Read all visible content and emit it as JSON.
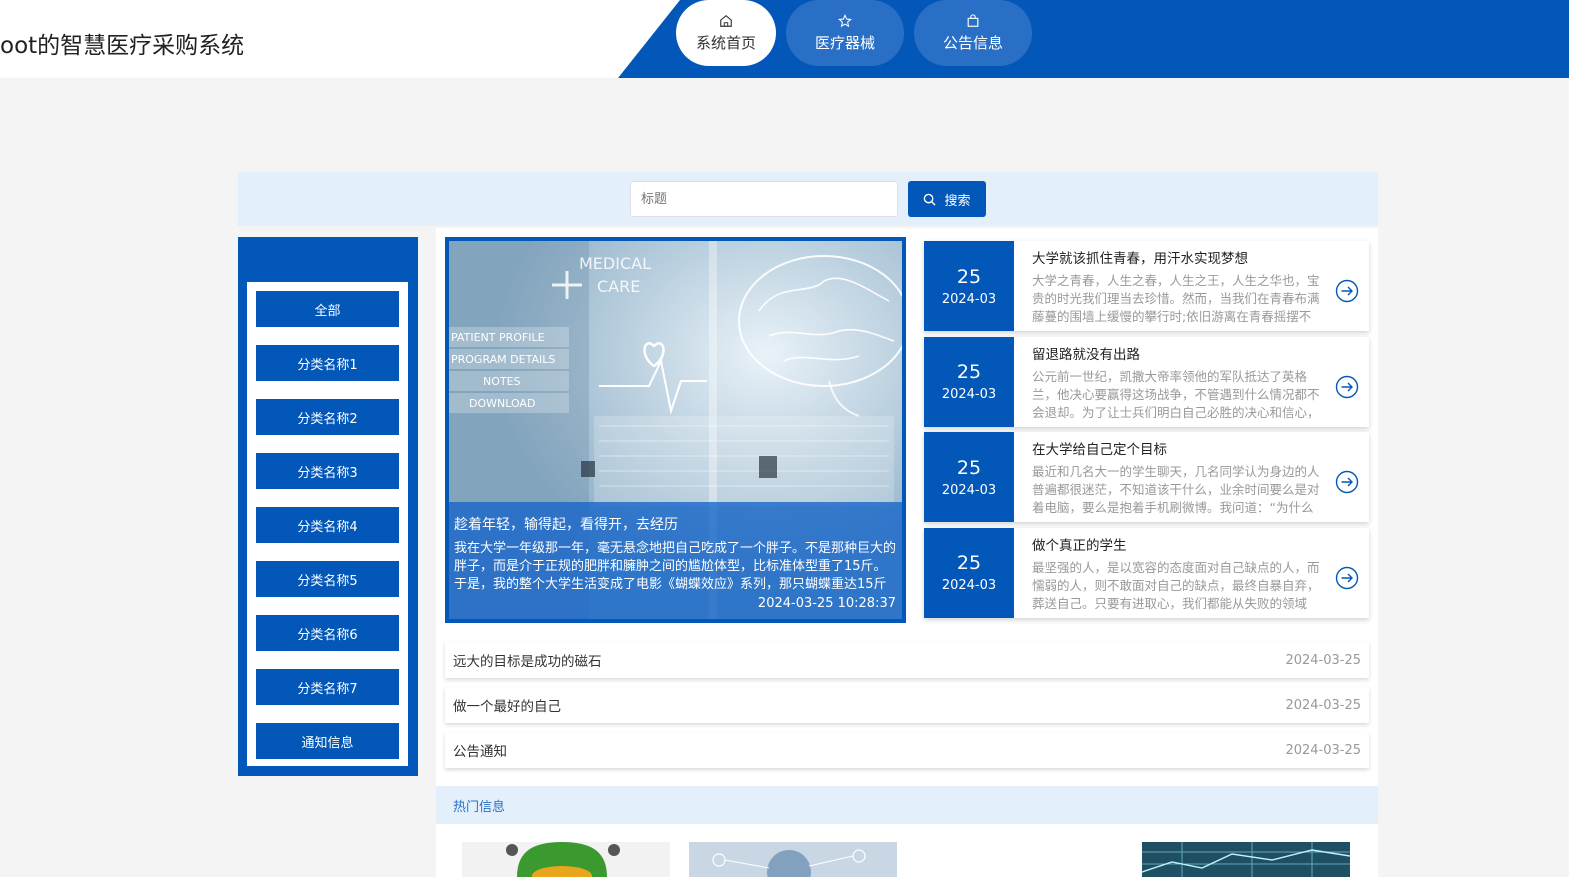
{
  "header": {
    "site_title": "oot的智慧医疗采购系统",
    "nav": [
      {
        "label": "系统首页",
        "icon": "home-icon",
        "active": true
      },
      {
        "label": "医疗器械",
        "icon": "star-icon",
        "active": false
      },
      {
        "label": "公告信息",
        "icon": "bag-icon",
        "active": false
      }
    ]
  },
  "search": {
    "placeholder": "标题",
    "button_label": "搜索"
  },
  "sidebar": {
    "categories": [
      "全部",
      "分类名称1",
      "分类名称2",
      "分类名称3",
      "分类名称4",
      "分类名称5",
      "分类名称6",
      "分类名称7",
      "通知信息"
    ]
  },
  "feature": {
    "image_text": {
      "line1": "MEDICAL",
      "line2": "CARE",
      "menu": [
        "PATIENT PROFILE",
        "PROGRAM DETAILS",
        "NOTES",
        "DOWNLOAD"
      ]
    },
    "title": "趁着年轻，输得起，看得开，去经历",
    "desc": "我在大学一年级那一年，毫无悬念地把自己吃成了一个胖子。不是那种巨大的胖子，而是介于正规的肥胖和臃肿之间的尴尬体型，比标准体型重了15斤。于是，我的整个大学生活变成了电影《蝴蝶效应》系列，那只蝴蝶重达15斤",
    "time": "2024-03-25 10:28:37"
  },
  "news": [
    {
      "day": "25",
      "ym": "2024-03",
      "title": "大学就该抓住青春，用汗水实现梦想",
      "desc": "大学之青春，人生之春，人生之王，人生之华也，宝贵的时光我们理当去珍惜。然而，当我们在青春布满藤蔓的围墙上缓慢的攀行时;依旧游离在青春摇摆不"
    },
    {
      "day": "25",
      "ym": "2024-03",
      "title": "留退路就没有出路",
      "desc": "公元前一世纪，凯撒大帝率领他的军队抵达了英格兰，他决心要赢得这场战争，不管遇到什么情况都不会退却。为了让士兵们明白自己必胜的决心和信心，"
    },
    {
      "day": "25",
      "ym": "2024-03",
      "title": "在大学给自己定个目标",
      "desc": "最近和几名大一的学生聊天，几名同学认为身边的人普遍都很迷茫，不知道该干什么，业余时间要么是对着电脑，要么是抱着手机刷微博。我问道：“为什么"
    },
    {
      "day": "25",
      "ym": "2024-03",
      "title": "做个真正的学生",
      "desc": "最坚强的人，是以宽容的态度面对自己缺点的人，而懦弱的人，则不敢面对自己的缺点，最终自暴自弃，葬送自己。只要有进取心，我们都能从失败的领域"
    }
  ],
  "notices": [
    {
      "title": "远大的目标是成功的磁石",
      "date": "2024-03-25"
    },
    {
      "title": "做一个最好的自己",
      "date": "2024-03-25"
    },
    {
      "title": "公告通知",
      "date": "2024-03-25"
    }
  ],
  "hot": {
    "label": "热门信息"
  },
  "colors": {
    "primary": "#0257b8",
    "light_panel": "#e3f0fc",
    "background": "#f4f4f4"
  }
}
